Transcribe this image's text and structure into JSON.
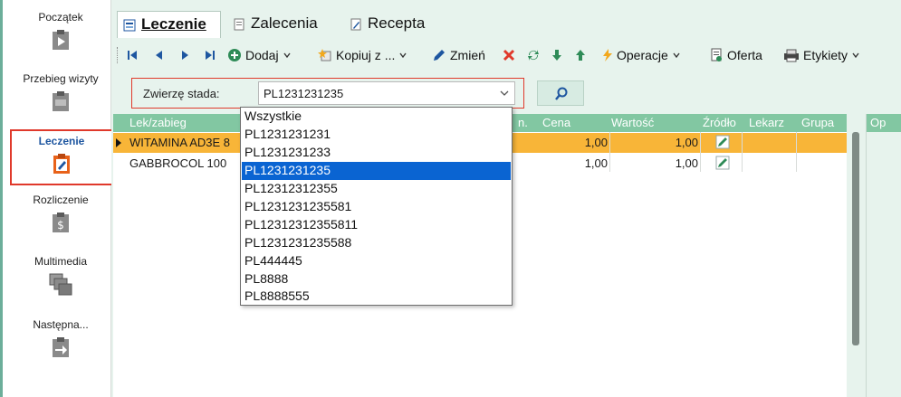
{
  "nav": {
    "items": [
      {
        "label": "Początek",
        "icon": "clipboard-play-icon"
      },
      {
        "label": "Przebieg wizyty",
        "icon": "clipboard-icon"
      },
      {
        "label": "Leczenie",
        "icon": "clipboard-medical-icon"
      },
      {
        "label": "Rozliczenie",
        "icon": "clipboard-dollar-icon"
      },
      {
        "label": "Multimedia",
        "icon": "images-icon"
      },
      {
        "label": "Następna...",
        "icon": "clipboard-arrow-icon"
      }
    ]
  },
  "tabs": [
    {
      "label": "Leczenie",
      "active": true
    },
    {
      "label": "Zalecenia",
      "active": false
    },
    {
      "label": "Recepta",
      "active": false
    }
  ],
  "toolbar": {
    "add_label": "Dodaj",
    "copy_label": "Kopiuj z ...",
    "edit_label": "Zmień",
    "operations_label": "Operacje",
    "offer_label": "Oferta",
    "labels_label": "Etykiety"
  },
  "filter": {
    "label": "Zwierzę stada:",
    "value": "PL1231231235"
  },
  "grid": {
    "columns": {
      "name": "Lek/zabieg",
      "qty": "n.",
      "price": "Cena",
      "value": "Wartość",
      "source": "Źródło",
      "doctor": "Lekarz",
      "group": "Grupa",
      "extra": "Op"
    },
    "rows": [
      {
        "name": "WITAMINA AD3E 8",
        "price": "1,00",
        "value": "1,00"
      },
      {
        "name": "GABBROCOL 100",
        "price": "1,00",
        "value": "1,00"
      }
    ]
  },
  "dropdown": {
    "options": [
      "Wszystkie",
      "PL1231231231",
      "PL1231231233",
      "PL1231231235",
      "PL12312312355",
      "PL1231231235581",
      "PL12312312355811",
      "PL1231231235588",
      "PL444445",
      "PL8888",
      "PL8888555"
    ],
    "selected": "PL1231231235"
  },
  "colors": {
    "accent": "#82c7a2",
    "selected_row": "#f8b538",
    "highlight": "#0a64d2",
    "active_border": "#e0392b",
    "delete": "#e0392b"
  }
}
